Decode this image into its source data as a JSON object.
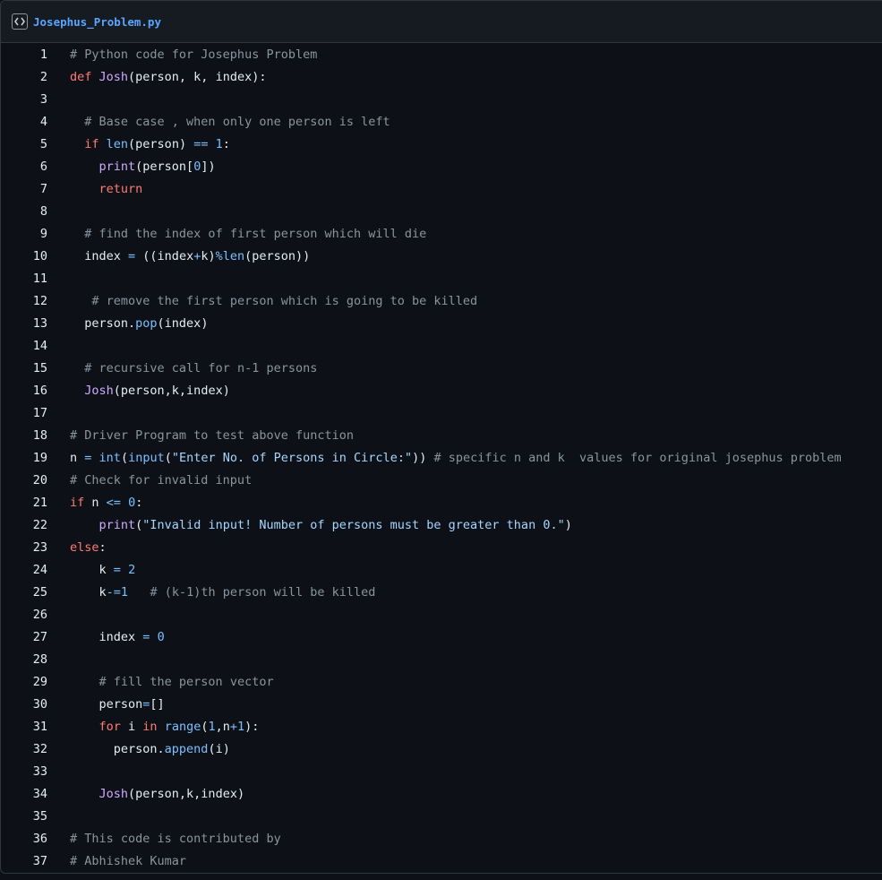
{
  "file": {
    "name": "Josephus_Problem.py",
    "icon": "code-file-icon"
  },
  "colors": {
    "background": "#0d1117",
    "header": "#161b22",
    "border": "#30363d",
    "filename": "#58a6ff",
    "text": "#e6edf3",
    "comment": "#8b949e",
    "keyword": "#ff7b72",
    "function": "#d2a8ff",
    "constant": "#79c0ff",
    "string": "#a5d6ff"
  },
  "lines": [
    {
      "n": "1",
      "tokens": [
        [
          "c",
          "# Python code for Josephus Problem"
        ]
      ]
    },
    {
      "n": "2",
      "tokens": [
        [
          "k",
          "def "
        ],
        [
          "f",
          "Josh"
        ],
        [
          "t",
          "(person, k, index):"
        ]
      ]
    },
    {
      "n": "3",
      "tokens": []
    },
    {
      "n": "4",
      "tokens": [
        [
          "t",
          "  "
        ],
        [
          "c",
          "# Base case , when only one person is left"
        ]
      ]
    },
    {
      "n": "5",
      "tokens": [
        [
          "t",
          "  "
        ],
        [
          "k",
          "if "
        ],
        [
          "b",
          "len"
        ],
        [
          "t",
          "(person) "
        ],
        [
          "o",
          "=="
        ],
        [
          "t",
          " "
        ],
        [
          "n",
          "1"
        ],
        [
          "t",
          ":"
        ]
      ]
    },
    {
      "n": "6",
      "tokens": [
        [
          "t",
          "    "
        ],
        [
          "f",
          "print"
        ],
        [
          "t",
          "(person["
        ],
        [
          "n",
          "0"
        ],
        [
          "t",
          "])"
        ]
      ]
    },
    {
      "n": "7",
      "tokens": [
        [
          "t",
          "    "
        ],
        [
          "k",
          "return"
        ]
      ]
    },
    {
      "n": "8",
      "tokens": []
    },
    {
      "n": "9",
      "tokens": [
        [
          "t",
          "  "
        ],
        [
          "c",
          "# find the index of first person which will die"
        ]
      ]
    },
    {
      "n": "10",
      "tokens": [
        [
          "t",
          "  index "
        ],
        [
          "o",
          "="
        ],
        [
          "t",
          " ((index"
        ],
        [
          "o",
          "+"
        ],
        [
          "t",
          "k)"
        ],
        [
          "o",
          "%"
        ],
        [
          "b",
          "len"
        ],
        [
          "t",
          "(person))"
        ]
      ]
    },
    {
      "n": "11",
      "tokens": []
    },
    {
      "n": "12",
      "tokens": [
        [
          "t",
          "   "
        ],
        [
          "c",
          "# remove the first person which is going to be killed"
        ]
      ]
    },
    {
      "n": "13",
      "tokens": [
        [
          "t",
          "  person."
        ],
        [
          "b",
          "pop"
        ],
        [
          "t",
          "(index)"
        ]
      ]
    },
    {
      "n": "14",
      "tokens": []
    },
    {
      "n": "15",
      "tokens": [
        [
          "t",
          "  "
        ],
        [
          "c",
          "# recursive call for n-1 persons"
        ]
      ]
    },
    {
      "n": "16",
      "tokens": [
        [
          "t",
          "  "
        ],
        [
          "f",
          "Josh"
        ],
        [
          "t",
          "(person,k,index)"
        ]
      ]
    },
    {
      "n": "17",
      "tokens": []
    },
    {
      "n": "18",
      "tokens": [
        [
          "c",
          "# Driver Program to test above function"
        ]
      ]
    },
    {
      "n": "19",
      "tokens": [
        [
          "t",
          "n "
        ],
        [
          "o",
          "="
        ],
        [
          "t",
          " "
        ],
        [
          "b",
          "int"
        ],
        [
          "t",
          "("
        ],
        [
          "b",
          "input"
        ],
        [
          "t",
          "("
        ],
        [
          "s",
          "\"Enter No. of Persons in Circle:\""
        ],
        [
          "t",
          ")) "
        ],
        [
          "c",
          "# specific n and k  values for original josephus problem"
        ]
      ]
    },
    {
      "n": "20",
      "tokens": [
        [
          "c",
          "# Check for invalid input"
        ]
      ]
    },
    {
      "n": "21",
      "tokens": [
        [
          "k",
          "if "
        ],
        [
          "t",
          "n "
        ],
        [
          "o",
          "<="
        ],
        [
          "t",
          " "
        ],
        [
          "n",
          "0"
        ],
        [
          "t",
          ":"
        ]
      ]
    },
    {
      "n": "22",
      "tokens": [
        [
          "t",
          "    "
        ],
        [
          "f",
          "print"
        ],
        [
          "t",
          "("
        ],
        [
          "s",
          "\"Invalid input! Number of persons must be greater than 0.\""
        ],
        [
          "t",
          ")"
        ]
      ]
    },
    {
      "n": "23",
      "tokens": [
        [
          "k",
          "else"
        ],
        [
          "t",
          ":"
        ]
      ]
    },
    {
      "n": "24",
      "tokens": [
        [
          "t",
          "    k "
        ],
        [
          "o",
          "="
        ],
        [
          "t",
          " "
        ],
        [
          "n",
          "2"
        ]
      ]
    },
    {
      "n": "25",
      "tokens": [
        [
          "t",
          "    k"
        ],
        [
          "o",
          "-="
        ],
        [
          "n",
          "1"
        ],
        [
          "t",
          "   "
        ],
        [
          "c",
          "# (k-1)th person will be killed"
        ]
      ]
    },
    {
      "n": "26",
      "tokens": []
    },
    {
      "n": "27",
      "tokens": [
        [
          "t",
          "    index "
        ],
        [
          "o",
          "="
        ],
        [
          "t",
          " "
        ],
        [
          "n",
          "0"
        ]
      ]
    },
    {
      "n": "28",
      "tokens": []
    },
    {
      "n": "29",
      "tokens": [
        [
          "t",
          "    "
        ],
        [
          "c",
          "# fill the person vector"
        ]
      ]
    },
    {
      "n": "30",
      "tokens": [
        [
          "t",
          "    person"
        ],
        [
          "o",
          "="
        ],
        [
          "t",
          "[]"
        ]
      ]
    },
    {
      "n": "31",
      "tokens": [
        [
          "t",
          "    "
        ],
        [
          "k",
          "for "
        ],
        [
          "t",
          "i "
        ],
        [
          "k",
          "in "
        ],
        [
          "b",
          "range"
        ],
        [
          "t",
          "("
        ],
        [
          "n",
          "1"
        ],
        [
          "t",
          ",n"
        ],
        [
          "o",
          "+"
        ],
        [
          "n",
          "1"
        ],
        [
          "t",
          "):"
        ]
      ]
    },
    {
      "n": "32",
      "tokens": [
        [
          "t",
          "      person."
        ],
        [
          "b",
          "append"
        ],
        [
          "t",
          "(i)"
        ]
      ]
    },
    {
      "n": "33",
      "tokens": []
    },
    {
      "n": "34",
      "tokens": [
        [
          "t",
          "    "
        ],
        [
          "f",
          "Josh"
        ],
        [
          "t",
          "(person,k,index)"
        ]
      ]
    },
    {
      "n": "35",
      "tokens": []
    },
    {
      "n": "36",
      "tokens": [
        [
          "c",
          "# This code is contributed by"
        ]
      ]
    },
    {
      "n": "37",
      "tokens": [
        [
          "c",
          "# Abhishek Kumar"
        ]
      ]
    }
  ]
}
